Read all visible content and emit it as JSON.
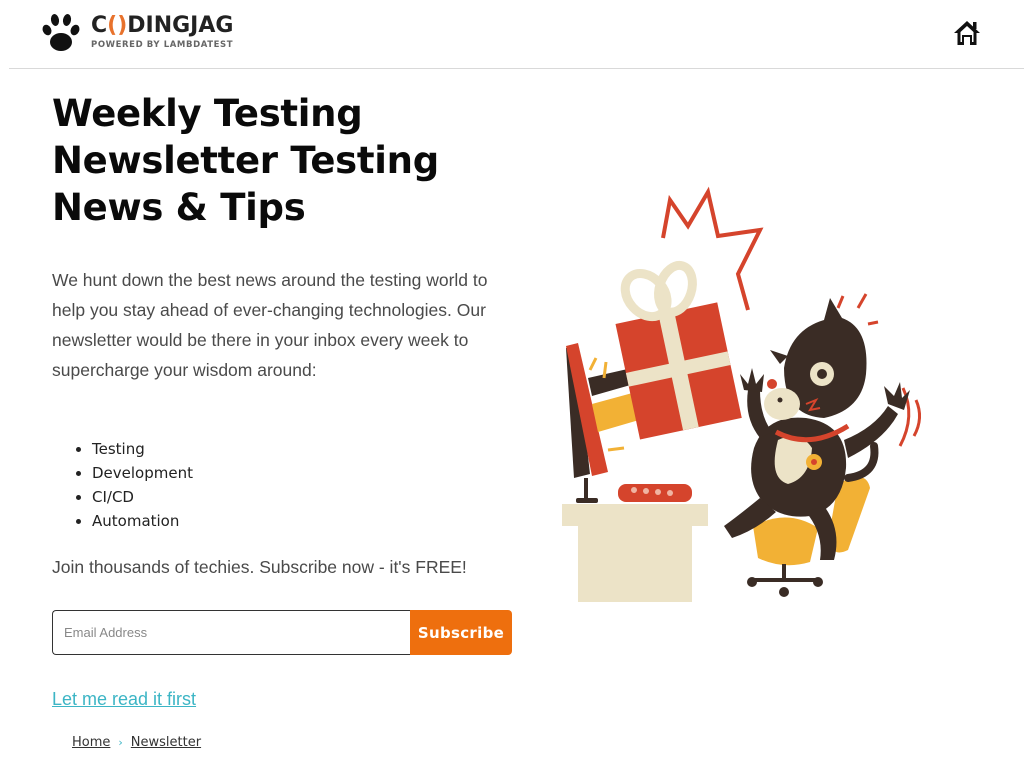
{
  "header": {
    "brand_name_pre": "C",
    "brand_name_bracket": "()",
    "brand_name_post": "DINGJAG",
    "brand_tagline": "POWERED BY LAMBDATEST",
    "home_icon": "home-icon",
    "logo_icon": "paw-icon"
  },
  "main": {
    "title": "Weekly Testing Newsletter Testing News & Tips",
    "lead": "We hunt down the best news around the testing world to help you stay ahead of ever-changing technologies. Our newsletter would be there in your inbox every week to supercharge your wisdom around:",
    "topics": [
      "Testing",
      "Development",
      "CI/CD",
      "Automation"
    ],
    "join_text": "Join thousands of techies. Subscribe now - it's FREE!",
    "form": {
      "email_placeholder": "Email Address",
      "email_value": "",
      "subscribe_label": "Subscribe"
    },
    "read_first_label": "Let me read it first"
  },
  "breadcrumb": {
    "items": [
      "Home",
      "Newsletter"
    ],
    "separator": "›"
  },
  "colors": {
    "accent_orange": "#ee6f0e",
    "link_teal": "#3cb5c5",
    "gift_red": "#d5442c",
    "cat_dark": "#3a2c25",
    "desk_cream": "#ece3c7",
    "chair_yellow": "#f2b135"
  },
  "illustration": {
    "subject": "cat-receiving-gift-from-monitor-illustration"
  }
}
